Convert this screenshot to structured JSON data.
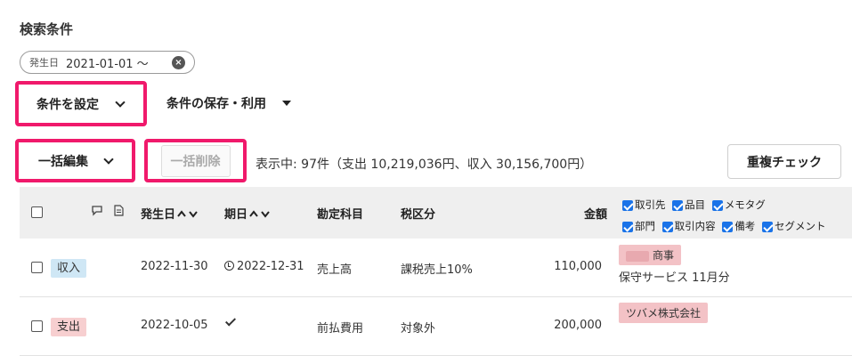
{
  "search": {
    "title": "検索条件",
    "chip_label": "発生日",
    "chip_value": "2021-01-01 〜",
    "clear_icon": "×"
  },
  "toolbar": {
    "set_conditions": "条件を設定",
    "save_use": "条件の保存・利用",
    "bulk_edit": "一括編集",
    "bulk_delete": "一括削除",
    "summary": "表示中: 97件（支出 10,219,036円、収入 30,156,700円）",
    "duplicate_check": "重複チェック"
  },
  "table": {
    "headers": {
      "date": "発生日",
      "due": "期日",
      "account": "勘定科目",
      "tax": "税区分",
      "amount": "金額"
    },
    "sort_arrows": "⌃⌄",
    "column_options": [
      {
        "label": "取引先",
        "checked": true
      },
      {
        "label": "品目",
        "checked": true
      },
      {
        "label": "メモタグ",
        "checked": true
      },
      {
        "label": "部門",
        "checked": true
      },
      {
        "label": "取引内容",
        "checked": true
      },
      {
        "label": "備考",
        "checked": true
      },
      {
        "label": "セグメント",
        "checked": true
      }
    ],
    "rows": [
      {
        "type": "収入",
        "date": "2022-11-30",
        "due": "2022-12-31",
        "account": "売上高",
        "tax": "課税売上10%",
        "amount": "110,000",
        "partner": "商事",
        "item": "保守サービス 11月分"
      },
      {
        "type": "支出",
        "date": "2022-10-05",
        "due": "",
        "account": "前払費用",
        "tax": "対象外",
        "amount": "200,000",
        "partner": "ツバメ株式会社",
        "item": ""
      }
    ]
  },
  "colors": {
    "highlight": "#f0196b",
    "income_tag": "#cfe7f5",
    "expense_tag": "#f7cfd0",
    "partner_tag": "#f3c2c6",
    "header_bg": "#efefef"
  }
}
